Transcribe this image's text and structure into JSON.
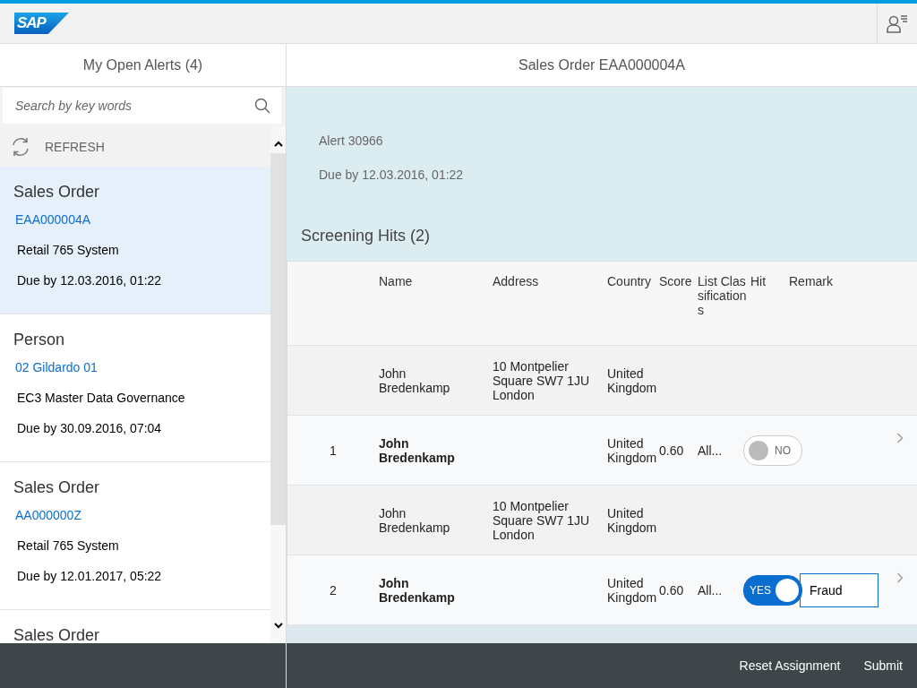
{
  "header": {
    "logo": "SAP"
  },
  "sidebar": {
    "title": "My Open Alerts (4)",
    "search": {
      "placeholder": "Search by key words"
    },
    "refresh": "REFRESH",
    "items": [
      {
        "type": "Sales Order",
        "link": "EAA000004A",
        "system": "Retail 765 System",
        "due": "Due by 12.03.2016, 01:22",
        "selected": true
      },
      {
        "type": "Person",
        "link": "02 Gildardo 01",
        "system": "EC3 Master Data Governance",
        "due": "Due by 30.09.2016, 07:04",
        "selected": false
      },
      {
        "type": "Sales Order",
        "link": "AA000000Z",
        "system": "Retail 765 System",
        "due": "Due by 12.01.2017, 05:22",
        "selected": false
      },
      {
        "type": "Sales Order",
        "selected": false
      }
    ]
  },
  "detail": {
    "title": "Sales Order EAA000004A",
    "alert": "Alert 30966",
    "due": "Due by 12.03.2016, 01:22",
    "section_title": "Screening Hits (2)",
    "table": {
      "columns": [
        "Name",
        "Address",
        "Country",
        "Score",
        "List Classifications",
        "Hit",
        "Remark"
      ],
      "rows": [
        {
          "kind": "detail",
          "name": "John Bredenkamp",
          "address": "10 Montpelier Square SW7 1JU London",
          "country": "United Kingdom"
        },
        {
          "kind": "hit",
          "index": "1",
          "name": "John Bredenkamp",
          "country": "United Kingdom",
          "score": "0.60",
          "list": "All...",
          "hit": {
            "on": false,
            "label": "NO"
          }
        },
        {
          "kind": "detail",
          "name": "John Bredenkamp",
          "address": "10 Montpelier Square SW7 1JU London",
          "country": "United Kingdom"
        },
        {
          "kind": "hit",
          "index": "2",
          "name": "John Bredenkamp",
          "country": "United Kingdom",
          "score": "0.60",
          "list": "All...",
          "hit": {
            "on": true,
            "label": "YES"
          },
          "remark": "Fraud"
        }
      ]
    }
  },
  "footer": {
    "buttons": [
      "Reset Assignment",
      "Submit"
    ]
  }
}
